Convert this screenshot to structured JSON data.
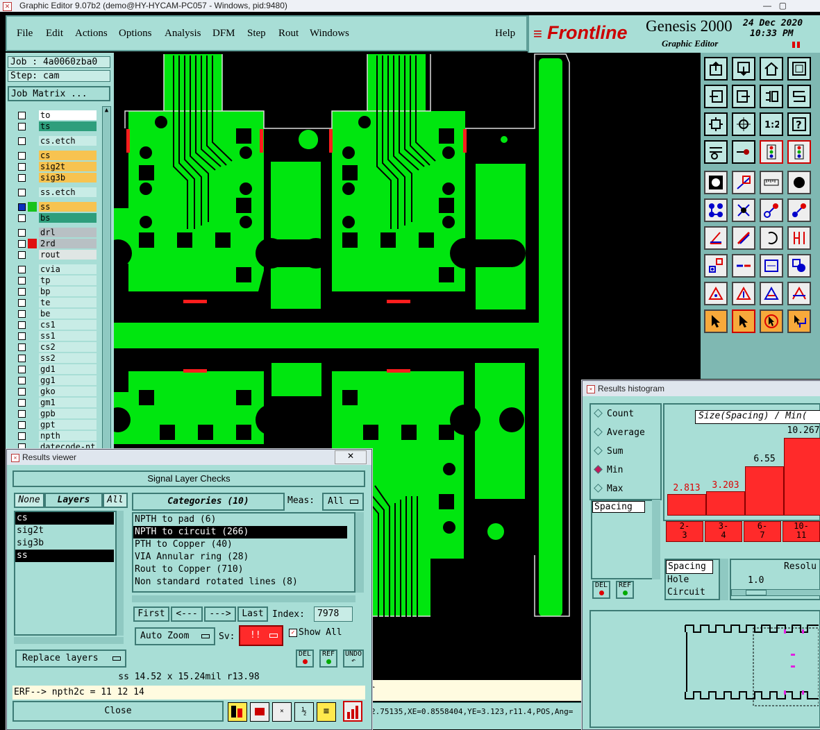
{
  "window_title": "Graphic Editor 9.07b2 (demo@HY-HYCAM-PC057 - Windows, pid:9480)",
  "menu": [
    "File",
    "Edit",
    "Actions",
    "Options",
    "Analysis",
    "DFM",
    "Step",
    "Rout",
    "Windows"
  ],
  "help": "Help",
  "brand": {
    "logo": "Frontline",
    "product": "Genesis 2000",
    "subtitle": "Graphic Editor",
    "date": "24 Dec 2020",
    "time": "10:33 PM"
  },
  "job": {
    "job": "Job : 4a0060zba0",
    "step": "Step: cam",
    "matrix_button": "Job Matrix ..."
  },
  "layers": [
    {
      "name": "to",
      "color": "#ffffff"
    },
    {
      "name": "ts",
      "color": "#2e9e7c"
    },
    {
      "name": "cs.etch",
      "color": "#c8ece6"
    },
    {
      "name": "cs",
      "color": "#f7c350"
    },
    {
      "name": "sig2t",
      "color": "#f7c350"
    },
    {
      "name": "sig3b",
      "color": "#f7c350"
    },
    {
      "name": "ss.etch",
      "color": "#c8ece6"
    },
    {
      "name": "ss",
      "color": "#f7c350"
    },
    {
      "name": "bs",
      "color": "#2e9e7c"
    },
    {
      "name": "drl",
      "color": "#b8c0c4"
    },
    {
      "name": "2rd",
      "color": "#b8c0c4"
    },
    {
      "name": "rout",
      "color": "#dfe6e4"
    },
    {
      "name": "cvia",
      "color": "#c8ece6"
    },
    {
      "name": "tp",
      "color": "#c8ece6"
    },
    {
      "name": "bp",
      "color": "#c8ece6"
    },
    {
      "name": "te",
      "color": "#c8ece6"
    },
    {
      "name": "be",
      "color": "#c8ece6"
    },
    {
      "name": "cs1",
      "color": "#c8ece6"
    },
    {
      "name": "ss1",
      "color": "#c8ece6"
    },
    {
      "name": "cs2",
      "color": "#c8ece6"
    },
    {
      "name": "ss2",
      "color": "#c8ece6"
    },
    {
      "name": "gd1",
      "color": "#c8ece6"
    },
    {
      "name": "gg1",
      "color": "#c8ece6"
    },
    {
      "name": "gko",
      "color": "#c8ece6"
    },
    {
      "name": "gm1",
      "color": "#c8ece6"
    },
    {
      "name": "gpb",
      "color": "#c8ece6"
    },
    {
      "name": "gpt",
      "color": "#c8ece6"
    },
    {
      "name": "npth",
      "color": "#c8ece6"
    },
    {
      "name": "datecode-nt",
      "color": "#c8ece6"
    }
  ],
  "results_viewer": {
    "title": "Results viewer",
    "header": "Signal Layer Checks",
    "none": "None",
    "layers": "Layers",
    "all": "All",
    "categories": "Categories (10)",
    "meas_label": "Meas:",
    "meas_value": "All",
    "layer_list": [
      "cs",
      "sig2t",
      "sig3b",
      "ss"
    ],
    "category_list": [
      "NPTH to pad (6)",
      "NPTH to circuit (266)",
      "PTH to Copper (40)",
      "VIA Annular ring (28)",
      "Rout to Copper (710)",
      "Non standard rotated lines (8)"
    ],
    "nav": {
      "first": "First",
      "prev": "<---",
      "next": "--->",
      "last": "Last",
      "index_label": "Index:",
      "index_value": "7978"
    },
    "auto_zoom": "Auto Zoom",
    "sv_label": "Sv:",
    "sv_value": "!!",
    "show_all": "Show All",
    "replace_layers": "Replace layers",
    "del": "DEL",
    "ref": "REF",
    "undo": "UNDO",
    "measure": "ss 14.52 x 15.24mil  r13.98",
    "erf": "ERF--> npth2c = 11 12 14",
    "close": "Close"
  },
  "histogram": {
    "title": "Results histogram",
    "options": [
      "Count",
      "Average",
      "Sum",
      "Min",
      "Max"
    ],
    "selected_option": "Min",
    "type_list": [
      "Spacing"
    ],
    "heading": "Size(Spacing) / Min(",
    "bars": [
      {
        "label": "2-\n3",
        "value": "2.813"
      },
      {
        "label": "3-\n4",
        "value": "3.203"
      },
      {
        "label": "6-\n7",
        "value": "6.55"
      },
      {
        "label": "10-\n11",
        "value": "10.267"
      }
    ],
    "list2": [
      "Spacing",
      "Hole",
      "Circuit"
    ],
    "resolution_label": "Resolu",
    "resolution_value": "1.0",
    "del": "DEL",
    "ref": "REF"
  },
  "status": {
    "coords": "2.75135,XE=0.8558404,YE=3.123,r11.4,POS,Ang=",
    "prompt_tail": "r"
  }
}
